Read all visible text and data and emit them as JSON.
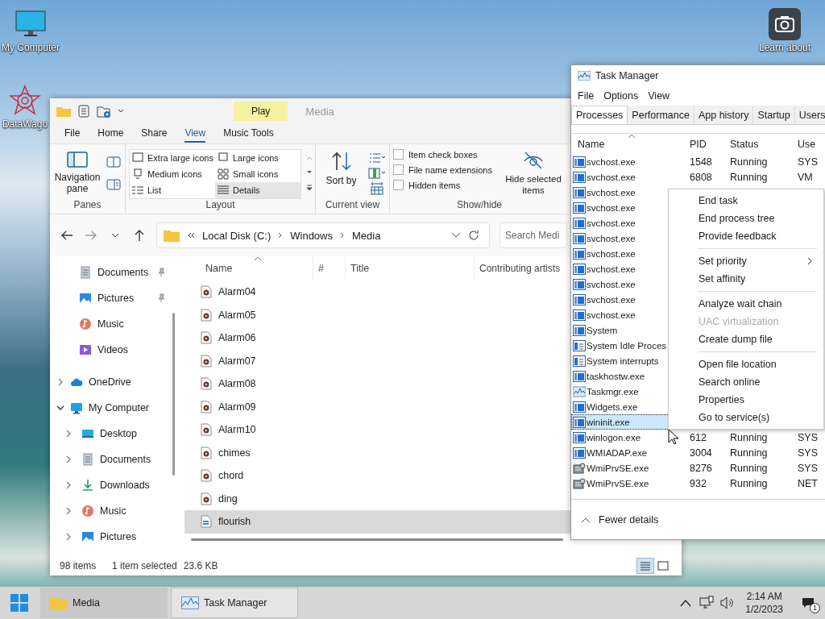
{
  "desktop_icons": [
    {
      "label": "My Computer",
      "kind": "computer"
    },
    {
      "label": "DataWago",
      "kind": "app"
    },
    {
      "label": "Learn about",
      "kind": "camera"
    }
  ],
  "explorer": {
    "contextual_tab": "Play",
    "title": "Media",
    "tabs": [
      {
        "label": "File",
        "selected": false
      },
      {
        "label": "Home",
        "selected": false
      },
      {
        "label": "Share",
        "selected": false
      },
      {
        "label": "View",
        "selected": true
      },
      {
        "label": "Music Tools",
        "selected": false
      }
    ],
    "ribbon": {
      "panes": {
        "navigation_pane": "Navigation pane",
        "label": "Panes"
      },
      "layout": {
        "label": "Layout",
        "options": [
          {
            "label": "Extra large icons",
            "selected": false
          },
          {
            "label": "Large icons",
            "selected": false
          },
          {
            "label": "Medium icons",
            "selected": false
          },
          {
            "label": "Small icons",
            "selected": false
          },
          {
            "label": "List",
            "selected": false
          },
          {
            "label": "Details",
            "selected": true
          }
        ]
      },
      "current_view": {
        "sort": "Sort by",
        "label": "Current view"
      },
      "show_hide": {
        "label": "Show/hide",
        "checkboxes": [
          {
            "label": "Item check boxes",
            "checked": false
          },
          {
            "label": "File name extensions",
            "checked": false
          },
          {
            "label": "Hidden items",
            "checked": false
          }
        ],
        "hide_selected": "Hide selected items"
      }
    },
    "address": {
      "crumbs": [
        "Local Disk (C:)",
        "Windows",
        "Media"
      ],
      "search_placeholder": "Search Medi"
    },
    "quick_access_items": [
      {
        "label": "Documents",
        "kind": "documents",
        "pinned": true
      },
      {
        "label": "Pictures",
        "kind": "pictures",
        "pinned": true
      },
      {
        "label": "Music",
        "kind": "music",
        "pinned": false
      },
      {
        "label": "Videos",
        "kind": "videos",
        "pinned": false
      }
    ],
    "tree": [
      {
        "label": "OneDrive",
        "kind": "cloud",
        "expanded": false
      },
      {
        "label": "My Computer",
        "kind": "computer",
        "expanded": true,
        "children": [
          {
            "label": "Desktop",
            "kind": "desktop",
            "expanded": false
          },
          {
            "label": "Documents",
            "kind": "documents",
            "expanded": false
          },
          {
            "label": "Downloads",
            "kind": "downloads",
            "expanded": false
          },
          {
            "label": "Music",
            "kind": "music",
            "expanded": false
          },
          {
            "label": "Pictures",
            "kind": "pictures",
            "expanded": false
          }
        ]
      }
    ],
    "columns": [
      "Name",
      "#",
      "Title",
      "Contributing artists"
    ],
    "files": [
      {
        "name": "Alarm04",
        "kind": "audio",
        "selected": false
      },
      {
        "name": "Alarm05",
        "kind": "audio",
        "selected": false
      },
      {
        "name": "Alarm06",
        "kind": "audio",
        "selected": false
      },
      {
        "name": "Alarm07",
        "kind": "audio",
        "selected": false
      },
      {
        "name": "Alarm08",
        "kind": "audio",
        "selected": false
      },
      {
        "name": "Alarm09",
        "kind": "audio",
        "selected": false
      },
      {
        "name": "Alarm10",
        "kind": "audio",
        "selected": false
      },
      {
        "name": "chimes",
        "kind": "audio",
        "selected": false
      },
      {
        "name": "chord",
        "kind": "audio",
        "selected": false
      },
      {
        "name": "ding",
        "kind": "audio",
        "selected": false
      },
      {
        "name": "flourish",
        "kind": "midi",
        "selected": true
      }
    ],
    "status": {
      "count": "98 items",
      "selection": "1 item selected",
      "size": "23.6 KB",
      "views": [
        {
          "kind": "details",
          "selected": true
        },
        {
          "kind": "tiles",
          "selected": false
        }
      ]
    }
  },
  "task_manager": {
    "title": "Task Manager",
    "menu": [
      "File",
      "Options",
      "View"
    ],
    "tabs": [
      {
        "label": "Processes",
        "selected": true
      },
      {
        "label": "Performance",
        "selected": false
      },
      {
        "label": "App history",
        "selected": false
      },
      {
        "label": "Startup",
        "selected": false
      },
      {
        "label": "Users",
        "selected": false
      }
    ],
    "columns": [
      "Name",
      "PID",
      "Status",
      "Use"
    ],
    "rows": [
      {
        "name": "svchost.exe",
        "kind": "service",
        "pid": "1548",
        "status": "Running",
        "user": "SYS",
        "selected": false
      },
      {
        "name": "svchost.exe",
        "kind": "service",
        "pid": "6808",
        "status": "Running",
        "user": "VM",
        "selected": false
      },
      {
        "name": "svchost.exe",
        "kind": "service",
        "selected": false
      },
      {
        "name": "svchost.exe",
        "kind": "service",
        "selected": false
      },
      {
        "name": "svchost.exe",
        "kind": "service",
        "selected": false
      },
      {
        "name": "svchost.exe",
        "kind": "service",
        "selected": false
      },
      {
        "name": "svchost.exe",
        "kind": "service",
        "selected": false
      },
      {
        "name": "svchost.exe",
        "kind": "service",
        "selected": false
      },
      {
        "name": "svchost.exe",
        "kind": "service",
        "selected": false
      },
      {
        "name": "svchost.exe",
        "kind": "service",
        "selected": false
      },
      {
        "name": "svchost.exe",
        "kind": "service",
        "selected": false
      },
      {
        "name": "System",
        "kind": "service",
        "selected": false
      },
      {
        "name": "System Idle Proces",
        "kind": "idle",
        "selected": false
      },
      {
        "name": "System interrupts",
        "kind": "idle",
        "selected": false
      },
      {
        "name": "taskhostw.exe",
        "kind": "service",
        "selected": false
      },
      {
        "name": "Taskmgr.exe",
        "kind": "chart",
        "selected": false
      },
      {
        "name": "Widgets.exe",
        "kind": "service",
        "selected": false
      },
      {
        "name": "wininit.exe",
        "kind": "service",
        "selected": true
      },
      {
        "name": "winlogon.exe",
        "kind": "service",
        "pid": "612",
        "status": "Running",
        "user": "SYS",
        "selected": false
      },
      {
        "name": "WMIADAP.exe",
        "kind": "service",
        "pid": "3004",
        "status": "Running",
        "user": "SYS",
        "selected": false
      },
      {
        "name": "WmiPrvSE.exe",
        "kind": "wmi",
        "pid": "8276",
        "status": "Running",
        "user": "SYS",
        "selected": false
      },
      {
        "name": "WmiPrvSE.exe",
        "kind": "wmi",
        "pid": "932",
        "status": "Running",
        "user": "NET",
        "selected": false
      }
    ],
    "fewer_details": "Fewer details"
  },
  "context_menu": [
    {
      "kind": "item",
      "label": "End task",
      "disabled": false,
      "submenu": false
    },
    {
      "kind": "item",
      "label": "End process tree",
      "disabled": false,
      "submenu": false
    },
    {
      "kind": "item",
      "label": "Provide feedback",
      "disabled": false,
      "submenu": false
    },
    {
      "kind": "separator"
    },
    {
      "kind": "item",
      "label": "Set priority",
      "disabled": false,
      "submenu": true
    },
    {
      "kind": "item",
      "label": "Set affinity",
      "disabled": false,
      "submenu": false
    },
    {
      "kind": "separator"
    },
    {
      "kind": "item",
      "label": "Analyze wait chain",
      "disabled": false,
      "submenu": false
    },
    {
      "kind": "item",
      "label": "UAC virtualization",
      "disabled": true,
      "submenu": false
    },
    {
      "kind": "item",
      "label": "Create dump file",
      "disabled": false,
      "submenu": false
    },
    {
      "kind": "separator"
    },
    {
      "kind": "item",
      "label": "Open file location",
      "disabled": false,
      "submenu": false
    },
    {
      "kind": "item",
      "label": "Search online",
      "disabled": false,
      "submenu": false
    },
    {
      "kind": "item",
      "label": "Properties",
      "disabled": false,
      "submenu": false
    },
    {
      "kind": "item",
      "label": "Go to service(s)",
      "disabled": false,
      "submenu": false
    }
  ],
  "taskbar": {
    "items": [
      {
        "label": "Media",
        "kind": "folder",
        "active": false
      },
      {
        "label": "Task Manager",
        "kind": "chart",
        "active": true
      }
    ],
    "time": "2:14 AM",
    "date": "1/2/2023",
    "notifications": "1"
  }
}
